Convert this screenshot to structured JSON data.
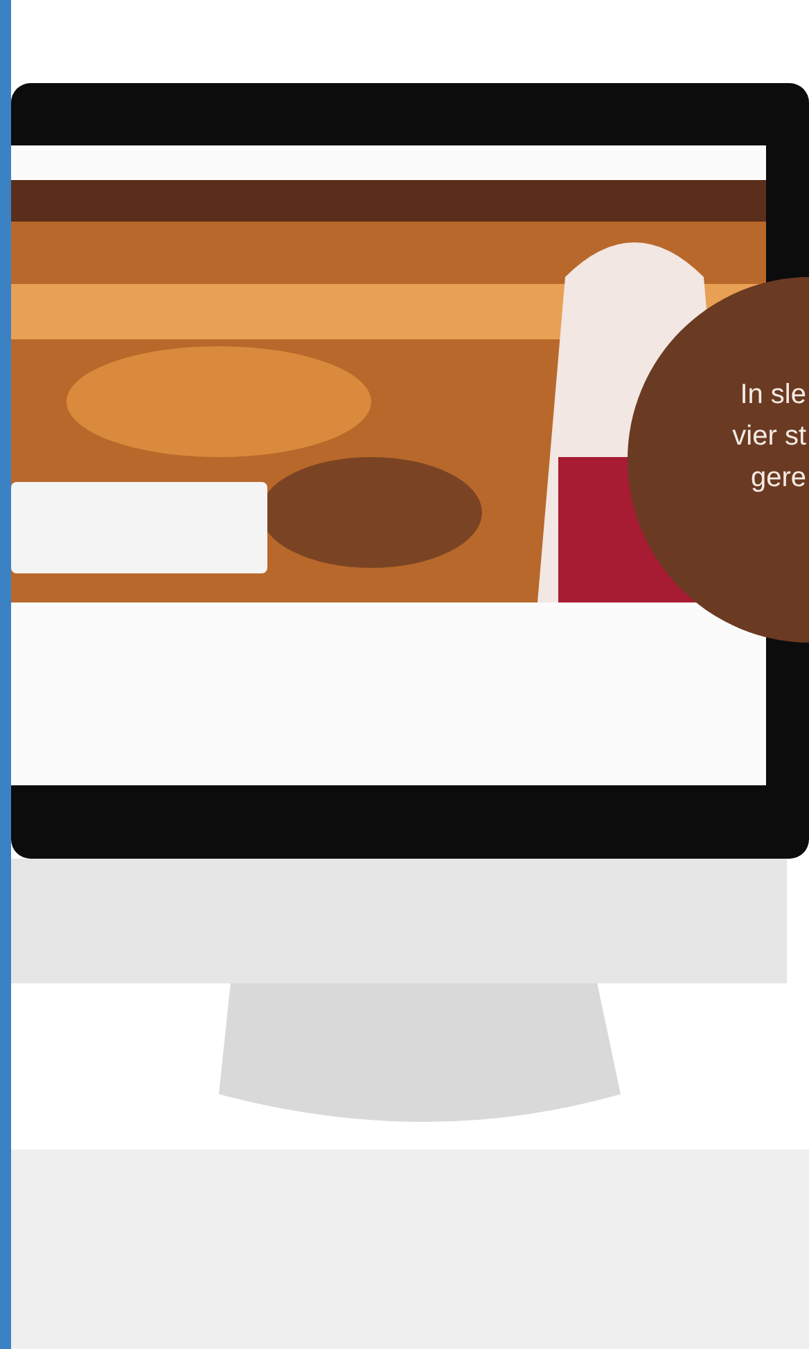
{
  "overlay": {
    "lines": [
      "In sle",
      "vier st",
      "gere"
    ]
  }
}
